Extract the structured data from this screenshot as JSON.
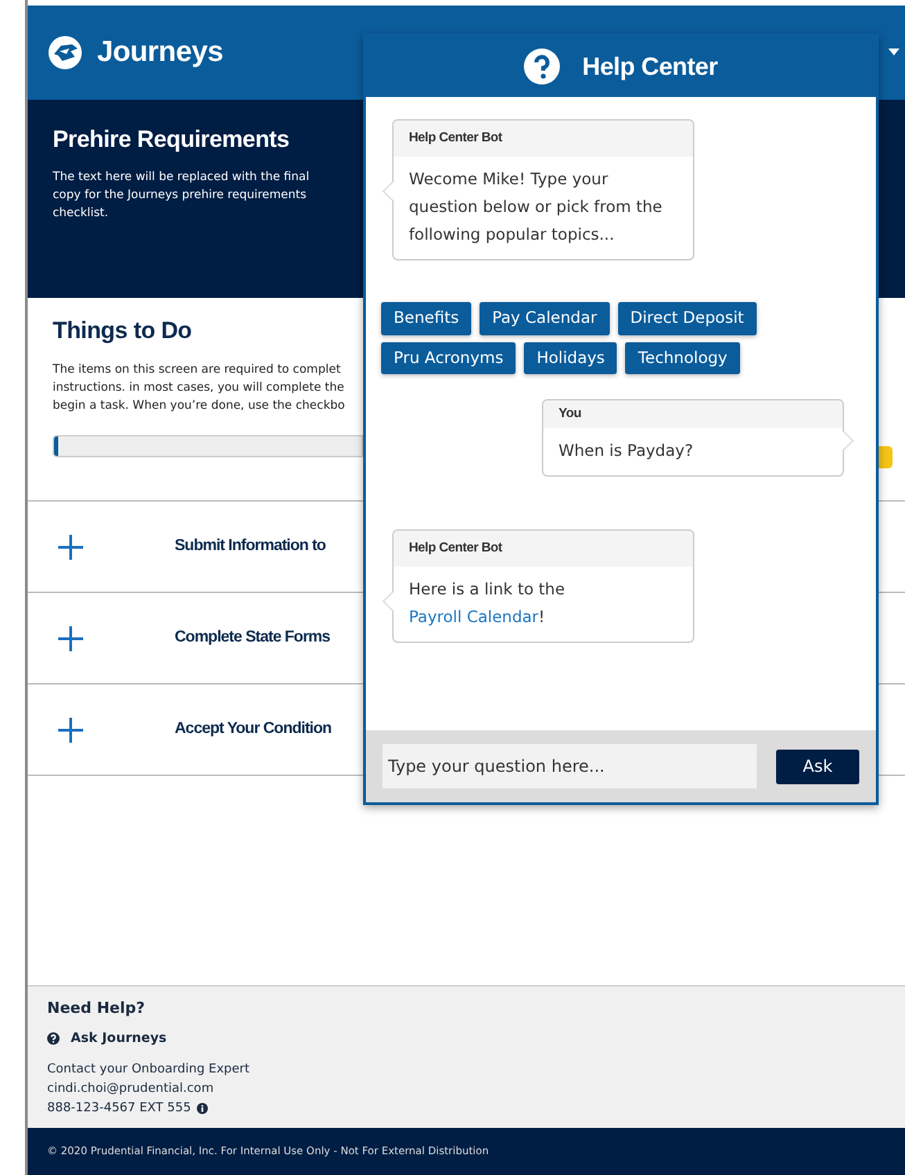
{
  "header": {
    "brand": "Journeys"
  },
  "banner": {
    "title": "Prehire Requirements",
    "text": "The text here will be replaced with the final copy for the Journeys prehire requirements checklist."
  },
  "things_to_do": {
    "title": "Things to Do",
    "lines": [
      "The items on this screen are required to complet",
      "instructions. in most cases, you will complete the",
      "begin a task. When you’re done, use the checkbo"
    ],
    "progress": {
      "level": 0.012
    }
  },
  "tasks": [
    {
      "title": "Submit Information to",
      "expanded": false
    },
    {
      "title": "Complete State Forms",
      "expanded": false
    },
    {
      "title": "Accept Your Condition",
      "expanded": false
    }
  ],
  "help_footer": {
    "title": "Need Help?",
    "ask": "Ask Journeys",
    "lines": [
      "Contact your Onboarding Expert",
      "cindi.choi@prudential.com",
      "888-123-4567 EXT 555"
    ]
  },
  "copyright": "© 2020 Prudential Financial, Inc. For Internal Use Only - Not For External Distribution",
  "help_center": {
    "title": "Help Center",
    "messages": [
      {
        "kind": "bot",
        "sender": "Help Center Bot",
        "parts": [
          {
            "text": "Wecome Mike! Type your question below or pick from the following popular topics..."
          }
        ]
      },
      {
        "kind": "topics",
        "topics": [
          "Benefits",
          "Pay Calendar",
          "Direct Deposit",
          "Pru Acronyms",
          "Holidays",
          "Technology"
        ]
      },
      {
        "kind": "user",
        "sender": "You",
        "parts": [
          {
            "text": "When is Payday?"
          }
        ]
      },
      {
        "kind": "bot",
        "sender": "Help Center Bot",
        "parts": [
          {
            "text": "Here is a link to the "
          },
          {
            "text": "Payroll Calendar",
            "link": true
          },
          {
            "text": "!"
          }
        ]
      }
    ],
    "input": {
      "placeholder": "Type your question here..."
    },
    "send": "Ask"
  }
}
